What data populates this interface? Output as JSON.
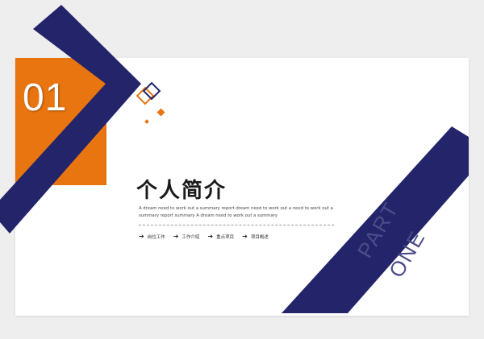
{
  "slide": {
    "number": "01",
    "title": "个人简介",
    "description": "A dream need to work out a summary report dream need to work out a need to work out a summary report summary A dream need to work out a summary",
    "menu_items": [
      {
        "label": "岗位工作",
        "icon": "arrow-right-icon"
      },
      {
        "label": "工作介绍",
        "icon": "arrow-right-icon"
      },
      {
        "label": "重点项目",
        "icon": "arrow-right-icon"
      },
      {
        "label": "项目概述",
        "icon": "arrow-right-icon"
      }
    ],
    "part_line1": "PART",
    "part_line2": "ONE"
  },
  "colors": {
    "navy": "#23246a",
    "orange": "#e87510",
    "background": "#eeeeee",
    "slide": "#ffffff"
  }
}
